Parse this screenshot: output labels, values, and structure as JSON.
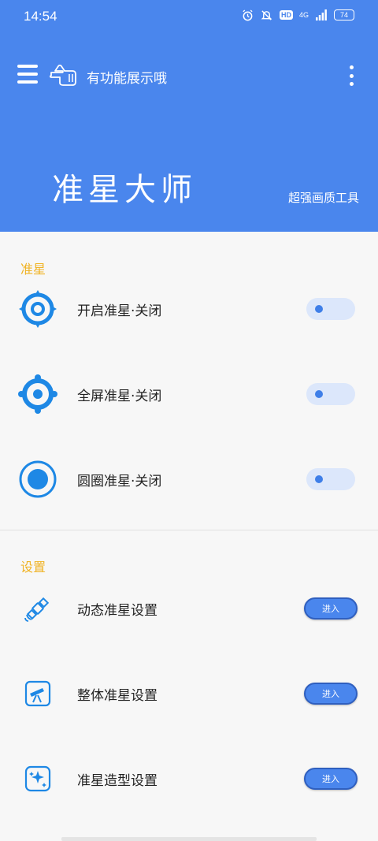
{
  "status_bar": {
    "time": "14:54",
    "network": "4G",
    "battery": "74",
    "icons": [
      "alarm-icon",
      "bell-off-icon",
      "hd-icon",
      "signal-icon",
      "battery-icon"
    ]
  },
  "toolbar": {
    "title": "有功能展示哦",
    "icons": [
      "menu-icon",
      "pointing-hand-icon",
      "more-vert-icon"
    ]
  },
  "hero": {
    "app_title": "准星大师",
    "subtitle": "超强画质工具"
  },
  "sections": {
    "crosshair": {
      "title": "准星",
      "items": [
        {
          "label": "开启准星·关闭",
          "icon": "crosshair-target-icon",
          "switch_on": false
        },
        {
          "label": "全屏准星·关闭",
          "icon": "crosshair-dot-icon",
          "switch_on": false
        },
        {
          "label": "圆圈准星·关闭",
          "icon": "circle-dot-icon",
          "switch_on": false
        }
      ]
    },
    "settings": {
      "title": "设置",
      "enter_label": "进入",
      "items": [
        {
          "label": "动态准星设置",
          "icon": "satellite-icon"
        },
        {
          "label": "整体准星设置",
          "icon": "telescope-icon"
        },
        {
          "label": "准星造型设置",
          "icon": "sparkle-frame-icon"
        }
      ]
    }
  },
  "colors": {
    "header_bg": "#4a86ed",
    "accent_blue": "#1e88e5",
    "section_title": "#f0b324",
    "switch_track": "#dce7fb"
  }
}
